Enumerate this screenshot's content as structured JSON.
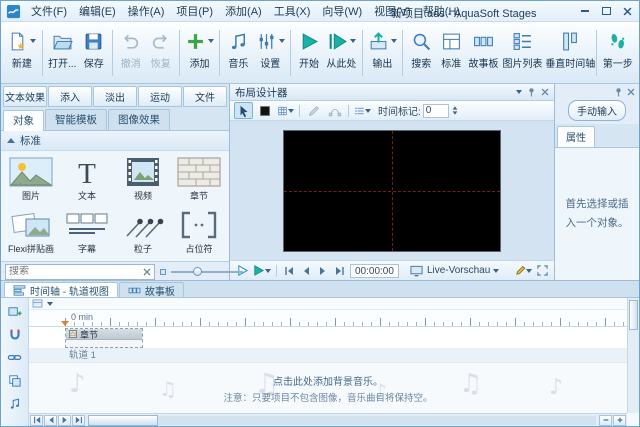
{
  "window": {
    "title": "新项目.ads - AquaSoft Stages",
    "menus": [
      "文件(F)",
      "编辑(E)",
      "操作(A)",
      "项目(P)",
      "添加(A)",
      "工具(X)",
      "向导(W)",
      "视图(V)",
      "帮助(H)"
    ]
  },
  "toolbar": {
    "buttons": [
      {
        "label": "新建"
      },
      {
        "label": "打开..."
      },
      {
        "label": "保存"
      },
      {
        "label": "撤消"
      },
      {
        "label": "恢复"
      },
      {
        "label": "添加"
      },
      {
        "label": "音乐"
      },
      {
        "label": "设置"
      },
      {
        "label": "开始"
      },
      {
        "label": "从此处"
      },
      {
        "label": "输出"
      },
      {
        "label": "搜索"
      },
      {
        "label": "标准"
      },
      {
        "label": "故事板"
      },
      {
        "label": "图片列表"
      },
      {
        "label": "垂直时间轴"
      },
      {
        "label": "第一步"
      }
    ]
  },
  "left_panel": {
    "effect_tabs": [
      "文本效果",
      "添入",
      "淡出",
      "运动",
      "文件"
    ],
    "object_tabs": [
      "对象",
      "智能模板",
      "图像效果"
    ],
    "section_title": "标准",
    "items": [
      "图片",
      "文本",
      "视频",
      "章节",
      "Flexi拼贴画",
      "字幕",
      "粒子",
      "占位符"
    ],
    "search": {
      "placeholder": "搜索"
    }
  },
  "layout_designer": {
    "title": "布局设计器",
    "time_mark_label": "时间标记:",
    "time_mark_value": "0",
    "time_display": "00:00:00",
    "preview_mode": "Live-Vorschau"
  },
  "right_panel": {
    "manual_input_label": "手动输入",
    "properties_tab": "属性",
    "hint": "首先选择或插入一个对象。"
  },
  "timeline": {
    "tabs": [
      "时间轴 - 轨道视图",
      "故事板"
    ],
    "ruler_start": "0 min",
    "chapter_label": "章节",
    "track_label": "轨道 1",
    "music_hint_line1": "点击此处添加背景音乐。",
    "music_hint_line2": "注意：只要项目不包含图像，音乐曲目将保持空。"
  },
  "colors": {
    "accent_blue": "#2e86c8",
    "teal": "#19b2a6",
    "panel_bg": "#e2edf7",
    "crosshair_red": "#7a1d1d"
  }
}
